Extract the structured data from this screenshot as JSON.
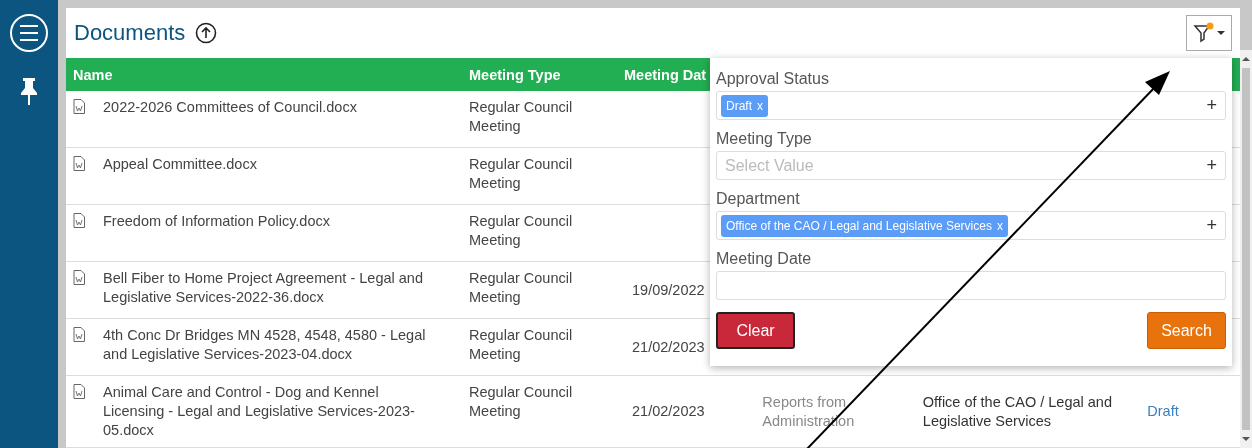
{
  "title": "Documents",
  "filter_button": {
    "active": true
  },
  "table": {
    "columns": [
      "Name",
      "Meeting Type",
      "Meeting Dat"
    ],
    "rows": [
      {
        "name": "2022-2026 Committees of Council.docx",
        "meeting_type": "Regular Council Meeting"
      },
      {
        "name": "Appeal Committee.docx",
        "meeting_type": "Regular Council Meeting"
      },
      {
        "name": "Freedom of Information Policy.docx",
        "meeting_type": "Regular Council Meeting"
      },
      {
        "name": "Bell Fiber to Home Project Agreement - Legal and Legislative Services-2022-36.docx",
        "meeting_type": "Regular Council Meeting",
        "meeting_date": "19/09/2022"
      },
      {
        "name": "4th Conc Dr Bridges MN 4528, 4548, 4580 - Legal and Legislative Services-2023-04.docx",
        "meeting_type": "Regular Council Meeting",
        "meeting_date": "21/02/2023"
      },
      {
        "name": "Animal Care and Control - Dog and Kennel Licensing - Legal and Legislative Services-2023-05.docx",
        "meeting_type": "Regular Council Meeting",
        "meeting_date": "21/02/2023",
        "column_4": "Reports from Administration",
        "column_5": "Office of the CAO / Legal and Legislative Services",
        "column_6": "Draft"
      }
    ]
  },
  "filter_panel": {
    "fields": [
      {
        "kind": "tags",
        "label": "Approval Status",
        "tags": [
          "Draft"
        ],
        "remove": "x",
        "add": "+"
      },
      {
        "kind": "tags",
        "label": "Meeting Type",
        "placeholder": "Select Value",
        "add": "+"
      },
      {
        "kind": "tags",
        "label": "Department",
        "tags": [
          "Office of the CAO / Legal and Legislative Services"
        ],
        "remove": "x",
        "add": "+"
      },
      {
        "kind": "date",
        "label": "Meeting Date"
      }
    ],
    "clear": "Clear",
    "search": "Search"
  }
}
